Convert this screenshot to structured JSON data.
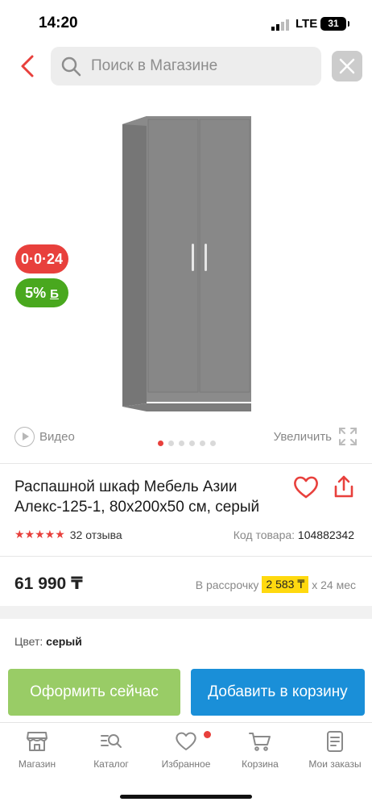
{
  "status_bar": {
    "time": "14:20",
    "network": "LTE",
    "battery": "31"
  },
  "header": {
    "search_placeholder": "Поиск в Магазине"
  },
  "gallery": {
    "badge_installment": "0·0·24",
    "badge_bonus": "5%",
    "badge_bonus_symbol": "Б",
    "video_label": "Видео",
    "zoom_label": "Увеличить",
    "dots_total": 6,
    "dots_active": 1
  },
  "product": {
    "title": "Распашной шкаф Мебель Азии Алекс-125-1, 80x200x50 см, серый",
    "rating_stars": 5,
    "reviews": "32 отзыва",
    "code_label": "Код товара:",
    "code_value": "104882342",
    "price": "61 990 ₸",
    "installment_prefix": "В рассрочку",
    "installment_amount": "2 583 ₸",
    "installment_suffix": "x 24 мес",
    "color_label": "Цвет:",
    "color_value": "серый"
  },
  "actions": {
    "checkout": "Оформить сейчас",
    "add_to_cart": "Добавить в корзину"
  },
  "nav": [
    {
      "label": "Магазин",
      "icon": "store-icon"
    },
    {
      "label": "Каталог",
      "icon": "catalog-search-icon"
    },
    {
      "label": "Избранное",
      "icon": "heart-icon"
    },
    {
      "label": "Корзина",
      "icon": "cart-icon"
    },
    {
      "label": "Мои заказы",
      "icon": "orders-icon"
    }
  ],
  "colors": {
    "accent_red": "#e8403c",
    "bonus_green": "#49a81e",
    "checkout_green": "#99cc66",
    "cart_blue": "#1a8fd8",
    "installment_yellow": "#ffd90f"
  }
}
